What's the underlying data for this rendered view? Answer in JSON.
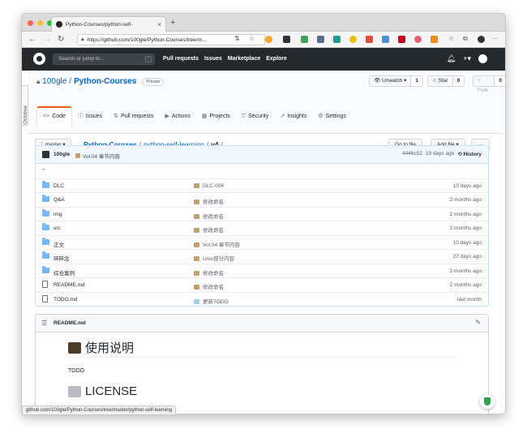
{
  "browser": {
    "tab_title": "Python-Courses/python-self-",
    "tab_close": "×",
    "new_tab": "+",
    "url": "https://github.com/100gle/Python-Courses/tree/m...",
    "colors": {
      "close": "#ff5f57",
      "minimize": "#febc2e",
      "zoom": "#28c840"
    }
  },
  "github": {
    "search_placeholder": "Search or jump to...",
    "search_key": "/",
    "nav": [
      "Pull requests",
      "Issues",
      "Marketplace",
      "Explore"
    ]
  },
  "octotree": {
    "label": "Octotree"
  },
  "repo": {
    "owner": "100gle",
    "separator": "/",
    "name": "Python-Courses",
    "visibility": "Private",
    "unwatch_label": "Unwatch ▾",
    "unwatch_count": "1",
    "star_label": "Star",
    "star_count": "0",
    "fork_label": "Fork",
    "fork_count": "0",
    "tabs": [
      {
        "icon": "<>",
        "label": "Code"
      },
      {
        "icon": "ⓘ",
        "label": "Issues"
      },
      {
        "icon": "⇅",
        "label": "Pull requests"
      },
      {
        "icon": "▶",
        "label": "Actions"
      },
      {
        "icon": "▦",
        "label": "Projects"
      },
      {
        "icon": "⛉",
        "label": "Security"
      },
      {
        "icon": "↗",
        "label": "Insights"
      },
      {
        "icon": "⚙",
        "label": "Settings"
      }
    ]
  },
  "branchbar": {
    "branch": "master",
    "crumbs": [
      "Python-Courses",
      "python-self-learning",
      "v4"
    ],
    "goto_file": "Go to file",
    "add_file": "Add file ▾",
    "more": "···"
  },
  "commit": {
    "author": "100gle",
    "message": "Vol.04 章节内容",
    "hash": "4446c52",
    "age": "10 days ago",
    "history": "History"
  },
  "files": {
    "parent": "..",
    "rows": [
      {
        "type": "folder",
        "name": "DLC",
        "message": "DLC-004",
        "age": "13 days ago"
      },
      {
        "type": "folder",
        "name": "Q&A",
        "message": "修改命名",
        "age": "2 months ago"
      },
      {
        "type": "folder",
        "name": "img",
        "message": "修改命名",
        "age": "2 months ago"
      },
      {
        "type": "folder",
        "name": "src",
        "message": "修改命名",
        "age": "2 months ago"
      },
      {
        "type": "folder",
        "name": "正文",
        "message": "Vol.04 章节内容",
        "age": "10 days ago"
      },
      {
        "type": "folder",
        "name": "碎碎念",
        "message": "Unix部分内容",
        "age": "27 days ago"
      },
      {
        "type": "folder",
        "name": "综合案例",
        "message": "修改命名",
        "age": "2 months ago"
      },
      {
        "type": "file",
        "name": "README.md",
        "message": "修改命名",
        "age": "2 months ago"
      },
      {
        "type": "file",
        "name": "TODO.md",
        "message": "更新TODO",
        "age": "last month"
      }
    ]
  },
  "readme": {
    "filename": "README.md",
    "heading1": "使用说明",
    "todo": "TODO",
    "heading2": "LICENSE"
  },
  "statusbar": {
    "url": "github.com/100gle/Python-Courses/tree/master/python-self-learning"
  }
}
